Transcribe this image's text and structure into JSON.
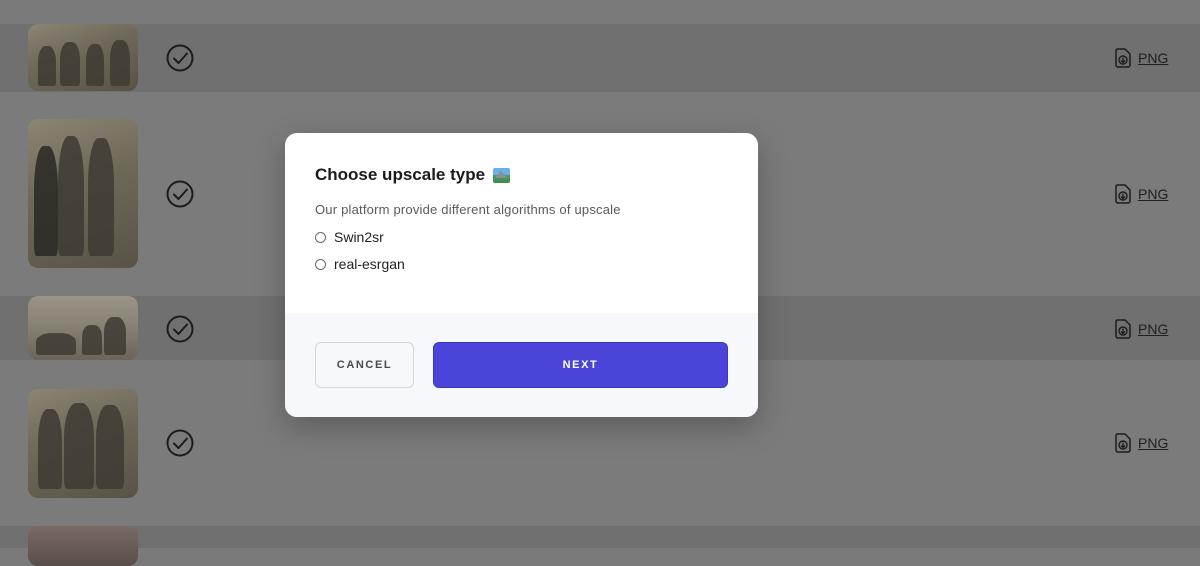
{
  "list": {
    "rows": [
      {
        "status": "done",
        "format_label": "PNG"
      },
      {
        "status": "done",
        "format_label": "PNG"
      },
      {
        "status": "done",
        "format_label": "PNG"
      },
      {
        "status": "done",
        "format_label": "PNG"
      }
    ]
  },
  "modal": {
    "title": "Choose upscale type",
    "title_emoji": "landscape-photo-emoji",
    "subtitle": "Our platform provide different algorithms of upscale",
    "options": [
      {
        "label": "Swin2sr",
        "selected": false
      },
      {
        "label": "real-esrgan",
        "selected": false
      }
    ],
    "cancel_label": "CANCEL",
    "next_label": "NEXT"
  },
  "colors": {
    "primary": "#4a44d8",
    "overlay": "#7a7a7a"
  }
}
